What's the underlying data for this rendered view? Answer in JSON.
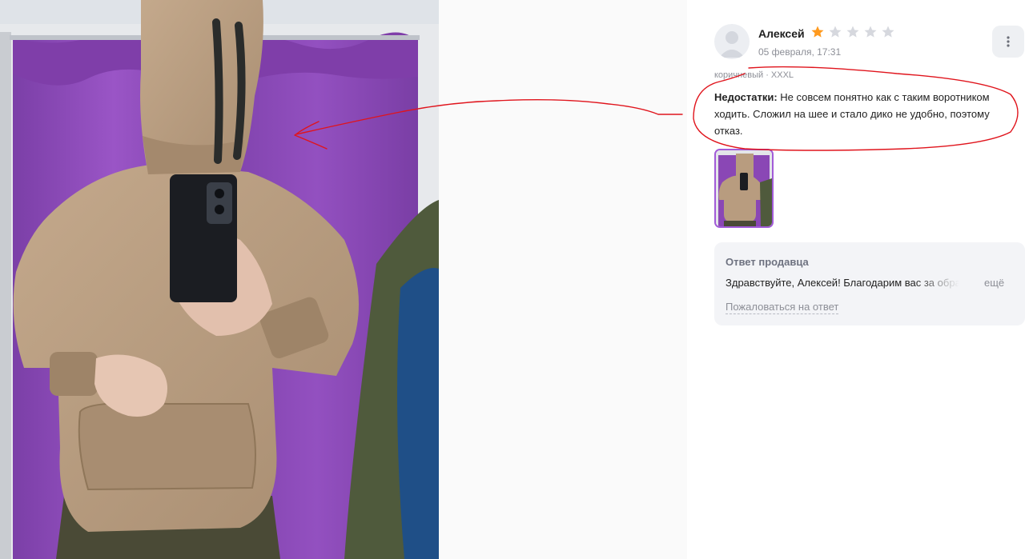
{
  "review": {
    "author": "Алексей",
    "date": "05 февраля, 17:31",
    "rating": 1,
    "rating_max": 5,
    "variant": "коричневый · XXXL",
    "text_label": "Недостатки:",
    "text_body": " Не совсем понятно как с таким воротником ходить. Сложил на шее и стало дико не удобно, поэтому отказ.",
    "star_color_on": "#ff9a1f",
    "star_color_off": "#d6d8de"
  },
  "seller_answer": {
    "title": "Ответ продавца",
    "text": "Здравствуйте, Алексей! Благодарим вас за обратную связь",
    "more": "ещё",
    "complain": "Пожаловаться на ответ"
  },
  "icons": {
    "avatar": "user-avatar-icon",
    "menu": "more-vertical-icon",
    "star": "star-icon"
  },
  "colors": {
    "annotation": "#e0141c",
    "thumb_border": "#a25bd8",
    "curtain": "#8e4bb9",
    "hoodie": "#b89c7f"
  }
}
